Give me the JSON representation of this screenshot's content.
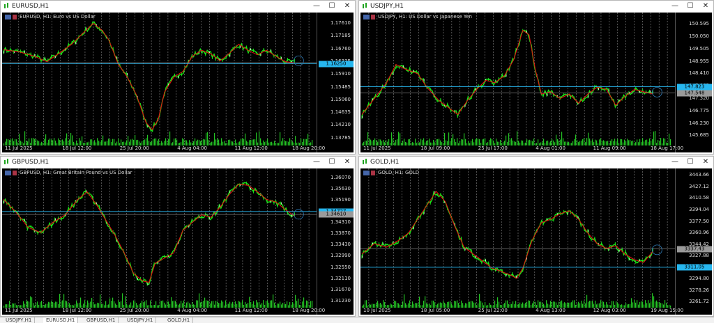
{
  "colors": {
    "up": "#18e618",
    "down": "#f0f0f0",
    "ma": "#e01010",
    "volume": "#24c424",
    "grid": "#8a8a8a",
    "bid": "#27b7ef",
    "ask": "#9a9a9a",
    "circle": "#2e79b4"
  },
  "windows": [
    {
      "title": "EURUSD,H1",
      "label": "EURUSD, H1:  Euro vs US Dollar",
      "yticks": [
        "1.17610",
        "1.17185",
        "1.16760",
        "1.16335",
        "1.15910",
        "1.15485",
        "1.15060",
        "1.14635",
        "1.14210",
        "1.13785"
      ],
      "ylim": [
        1.1357,
        1.1782
      ],
      "xlabels": [
        "11 Jul 2025",
        "18 Jul 12:00",
        "25 Jul 20:00",
        "4 Aug 04:00",
        "11 Aug 12:00",
        "18 Aug 20:00"
      ],
      "bid": {
        "value": 1.1625,
        "label": "1.16250"
      },
      "ask": {
        "value": 1.16285,
        "label": ""
      },
      "path": [
        [
          0,
          1.1672
        ],
        [
          0.05,
          1.1665
        ],
        [
          0.1,
          1.165
        ],
        [
          0.14,
          1.1632
        ],
        [
          0.18,
          1.166
        ],
        [
          0.22,
          1.169
        ],
        [
          0.26,
          1.173
        ],
        [
          0.29,
          1.176
        ],
        [
          0.32,
          1.1735
        ],
        [
          0.34,
          1.1705
        ],
        [
          0.37,
          1.1625
        ],
        [
          0.4,
          1.158
        ],
        [
          0.43,
          1.152
        ],
        [
          0.46,
          1.143
        ],
        [
          0.48,
          1.1405
        ],
        [
          0.5,
          1.144
        ],
        [
          0.52,
          1.153
        ],
        [
          0.55,
          1.158
        ],
        [
          0.58,
          1.16
        ],
        [
          0.61,
          1.165
        ],
        [
          0.64,
          1.167
        ],
        [
          0.67,
          1.1658
        ],
        [
          0.7,
          1.1635
        ],
        [
          0.73,
          1.166
        ],
        [
          0.76,
          1.169
        ],
        [
          0.79,
          1.167
        ],
        [
          0.82,
          1.1655
        ],
        [
          0.85,
          1.167
        ],
        [
          0.88,
          1.165
        ],
        [
          0.91,
          1.1632
        ],
        [
          0.94,
          1.1628
        ]
      ]
    },
    {
      "title": "USDJPY,H1",
      "label": "USDJPY, H1:  US Dollar vs Japanese Yen",
      "yticks": [
        "150.595",
        "150.050",
        "149.505",
        "148.955",
        "148.410",
        "147.865",
        "147.320",
        "146.775",
        "146.230",
        "145.685"
      ],
      "ylim": [
        145.3,
        150.9
      ],
      "xlabels": [
        "11 Jul 2025",
        "18 Jul 09:00",
        "25 Jul 17:00",
        "4 Aug 01:00",
        "11 Aug 09:00",
        "18 Aug 17:00"
      ],
      "bid": {
        "value": 147.823,
        "label": "147.823"
      },
      "ask": {
        "value": 147.548,
        "label": "147.548"
      },
      "path": [
        [
          0,
          146.6
        ],
        [
          0.04,
          147.3
        ],
        [
          0.08,
          148.0
        ],
        [
          0.11,
          148.8
        ],
        [
          0.14,
          148.6
        ],
        [
          0.18,
          148.4
        ],
        [
          0.21,
          147.8
        ],
        [
          0.25,
          147.2
        ],
        [
          0.28,
          146.9
        ],
        [
          0.31,
          146.6
        ],
        [
          0.34,
          147.2
        ],
        [
          0.37,
          147.7
        ],
        [
          0.4,
          148.1
        ],
        [
          0.43,
          148.0
        ],
        [
          0.46,
          148.3
        ],
        [
          0.49,
          149.0
        ],
        [
          0.52,
          150.3
        ],
        [
          0.54,
          150.1
        ],
        [
          0.56,
          148.6
        ],
        [
          0.58,
          147.5
        ],
        [
          0.61,
          147.6
        ],
        [
          0.64,
          147.3
        ],
        [
          0.67,
          147.5
        ],
        [
          0.7,
          147.1
        ],
        [
          0.73,
          147.5
        ],
        [
          0.76,
          147.8
        ],
        [
          0.79,
          147.7
        ],
        [
          0.82,
          147.0
        ],
        [
          0.85,
          147.4
        ],
        [
          0.88,
          147.7
        ],
        [
          0.91,
          147.6
        ],
        [
          0.94,
          147.5
        ]
      ]
    },
    {
      "title": "GBPUSD,H1",
      "label": "GBPUSD, H1:  Great Britain Pound vs US Dollar",
      "yticks": [
        "1.36070",
        "1.35630",
        "1.35190",
        "1.34750",
        "1.34310",
        "1.33870",
        "1.33430",
        "1.32990",
        "1.32550",
        "1.32110",
        "1.31670",
        "1.31230"
      ],
      "ylim": [
        1.3101,
        1.3625
      ],
      "xlabels": [
        "11 Jul 2025",
        "18 Jul 12:00",
        "25 Jul 20:00",
        "4 Aug 04:00",
        "11 Aug 12:00",
        "18 Aug 20:00"
      ],
      "bid": {
        "value": 1.34727,
        "label": "1.34727"
      },
      "ask": {
        "value": 1.3461,
        "label": "1.34610"
      },
      "path": [
        [
          0,
          1.352
        ],
        [
          0.04,
          1.347
        ],
        [
          0.08,
          1.341
        ],
        [
          0.12,
          1.339
        ],
        [
          0.16,
          1.343
        ],
        [
          0.2,
          1.346
        ],
        [
          0.24,
          1.352
        ],
        [
          0.27,
          1.355
        ],
        [
          0.3,
          1.35
        ],
        [
          0.33,
          1.344
        ],
        [
          0.36,
          1.338
        ],
        [
          0.39,
          1.331
        ],
        [
          0.42,
          1.323
        ],
        [
          0.45,
          1.32
        ],
        [
          0.47,
          1.3195
        ],
        [
          0.49,
          1.327
        ],
        [
          0.52,
          1.329
        ],
        [
          0.55,
          1.331
        ],
        [
          0.58,
          1.34
        ],
        [
          0.61,
          1.343
        ],
        [
          0.64,
          1.346
        ],
        [
          0.67,
          1.345
        ],
        [
          0.7,
          1.349
        ],
        [
          0.73,
          1.354
        ],
        [
          0.76,
          1.358
        ],
        [
          0.79,
          1.3575
        ],
        [
          0.82,
          1.355
        ],
        [
          0.85,
          1.352
        ],
        [
          0.88,
          1.351
        ],
        [
          0.91,
          1.348
        ],
        [
          0.94,
          1.3455
        ]
      ]
    },
    {
      "title": "GOLD,H1",
      "label": "GOLD, H1:  GOLD",
      "yticks": [
        "3443.66",
        "3427.12",
        "3410.58",
        "3394.04",
        "3377.50",
        "3360.96",
        "3344.42",
        "3327.88",
        "3311.35",
        "3294.80",
        "3278.26",
        "3261.72"
      ],
      "ylim": [
        3255,
        3447
      ],
      "xlabels": [
        "10 Jul 2025",
        "18 Jul 05:00",
        "25 Jul 22:00",
        "4 Aug 13:00",
        "12 Aug 03:00",
        "19 Aug 15:00"
      ],
      "bid": {
        "value": 3311.05,
        "label": "3311.05"
      },
      "ask": {
        "value": 3337.43,
        "label": "3337.43"
      },
      "path": [
        [
          0,
          3330
        ],
        [
          0.04,
          3345
        ],
        [
          0.08,
          3340
        ],
        [
          0.12,
          3350
        ],
        [
          0.15,
          3360
        ],
        [
          0.18,
          3380
        ],
        [
          0.21,
          3400
        ],
        [
          0.24,
          3420
        ],
        [
          0.27,
          3405
        ],
        [
          0.3,
          3370
        ],
        [
          0.33,
          3340
        ],
        [
          0.36,
          3330
        ],
        [
          0.39,
          3320
        ],
        [
          0.42,
          3310
        ],
        [
          0.45,
          3305
        ],
        [
          0.48,
          3300
        ],
        [
          0.5,
          3295
        ],
        [
          0.52,
          3310
        ],
        [
          0.55,
          3350
        ],
        [
          0.58,
          3375
        ],
        [
          0.61,
          3380
        ],
        [
          0.64,
          3388
        ],
        [
          0.67,
          3392
        ],
        [
          0.7,
          3380
        ],
        [
          0.73,
          3360
        ],
        [
          0.76,
          3345
        ],
        [
          0.79,
          3338
        ],
        [
          0.82,
          3342
        ],
        [
          0.85,
          3330
        ],
        [
          0.88,
          3322
        ],
        [
          0.91,
          3318
        ],
        [
          0.94,
          3334
        ]
      ]
    }
  ],
  "tabs": [
    "USDJPY,H1",
    "EURUSD,H1",
    "GBPUSD,H1",
    "USDJPY,H1",
    "GOLD,H1"
  ],
  "active_tab": 1
}
